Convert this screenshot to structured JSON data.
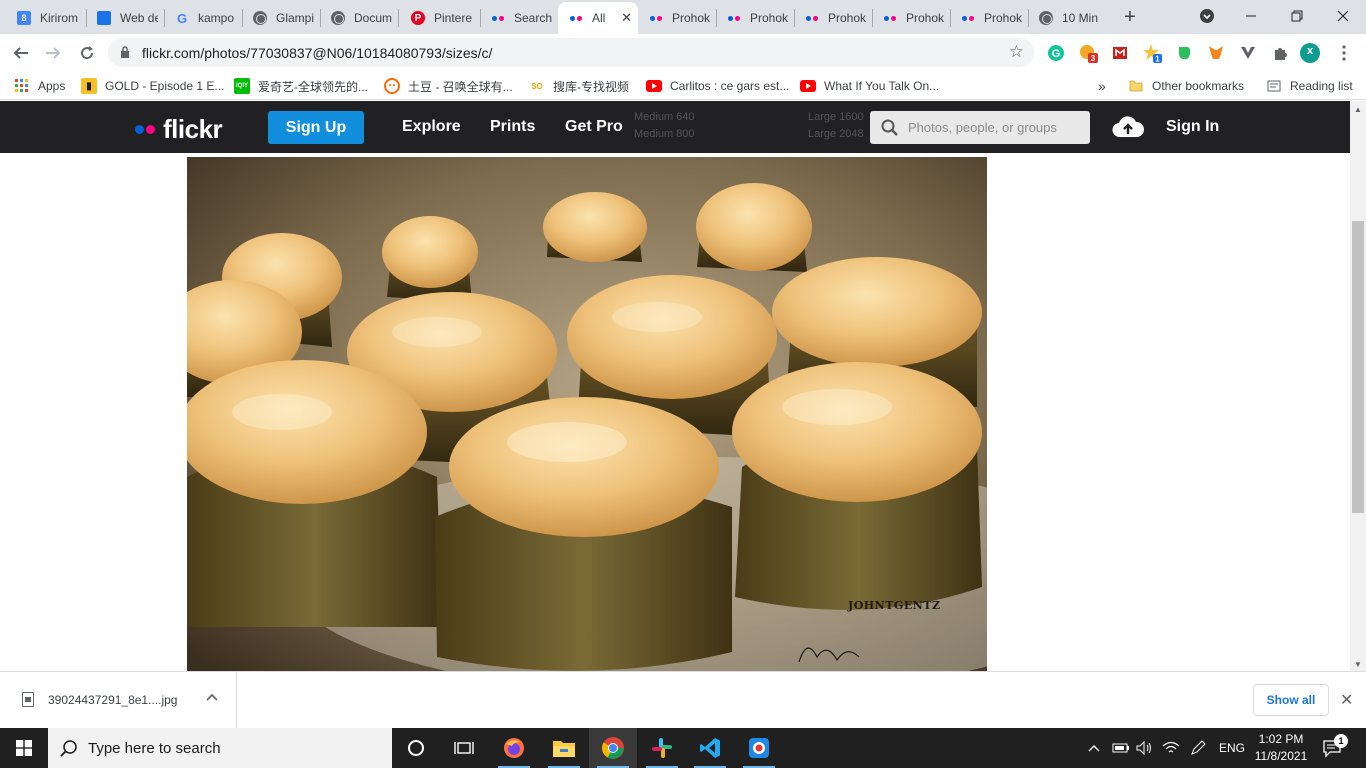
{
  "browser": {
    "tabs": [
      {
        "label": "Kirirom",
        "favicon": "calendar-icon",
        "favicon_text": "8"
      },
      {
        "label": "Web de",
        "favicon": "doc-icon"
      },
      {
        "label": "kampo",
        "favicon": "google-icon",
        "favicon_text": "G"
      },
      {
        "label": "Glampi",
        "favicon": "globe-icon"
      },
      {
        "label": "Docum",
        "favicon": "globe-icon"
      },
      {
        "label": "Pintere",
        "favicon": "pinterest-icon",
        "favicon_text": "P"
      },
      {
        "label": "Search",
        "favicon": "flickr-icon"
      },
      {
        "label": "All",
        "favicon": "flickr-icon",
        "active": true
      },
      {
        "label": "Prohok",
        "favicon": "flickr-icon"
      },
      {
        "label": "Prohok",
        "favicon": "flickr-icon"
      },
      {
        "label": "Prohok",
        "favicon": "flickr-icon"
      },
      {
        "label": "Prohok",
        "favicon": "flickr-icon"
      },
      {
        "label": "Prohok",
        "favicon": "flickr-icon"
      },
      {
        "label": "10 Min",
        "favicon": "globe-icon"
      }
    ],
    "tab_close_glyph": "✕",
    "new_tab_glyph": "+",
    "url": "flickr.com/photos/77030837@N06/10184080793/sizes/c/",
    "profile_initial": "x",
    "extension_badges": {
      "badge_a": "3",
      "badge_b": "1"
    },
    "bookmarks": [
      {
        "label": "Apps",
        "icon": "apps-grid-icon"
      },
      {
        "label": "GOLD - Episode 1 E...",
        "icon": "gold-icon"
      },
      {
        "label": "爱奇艺-全球领先的...",
        "icon": "iqiyi-icon",
        "icon_text": "iQIY"
      },
      {
        "label": "土豆 - 召唤全球有...",
        "icon": "tudou-icon"
      },
      {
        "label": "搜库-专找视频",
        "icon": "soku-icon",
        "icon_text": "SO"
      },
      {
        "label": "Carlitos : ce gars est...",
        "icon": "youtube-icon"
      },
      {
        "label": "What If You Talk On...",
        "icon": "youtube-icon"
      }
    ],
    "bookmarks_overflow": "»",
    "other_bookmarks": "Other bookmarks",
    "reading_list": "Reading list"
  },
  "flickr": {
    "logo_text": "flickr",
    "signup_label": "Sign Up",
    "nav": [
      "Explore",
      "Prints",
      "Get Pro"
    ],
    "search_placeholder": "Photos, people, or groups",
    "signin_label": "Sign In",
    "ghost_sizes": [
      "Medium 640",
      "Medium 800",
      "Large 1600",
      "Large 2048"
    ],
    "photo_credit": "JOHNTGENTZ",
    "colors": {
      "nav_bg": "#212124",
      "signup_bg": "#128fdc",
      "dot_blue": "#0063dc",
      "dot_pink": "#ff0084"
    }
  },
  "download_shelf": {
    "filename": "39024437291_8e1....jpg",
    "chevron": "^",
    "show_all_label": "Show all",
    "close_glyph": "✕"
  },
  "taskbar": {
    "search_placeholder": "Type here to search",
    "language": "ENG",
    "time": "1:02 PM",
    "date": "11/8/2021",
    "notification_count": "1"
  }
}
